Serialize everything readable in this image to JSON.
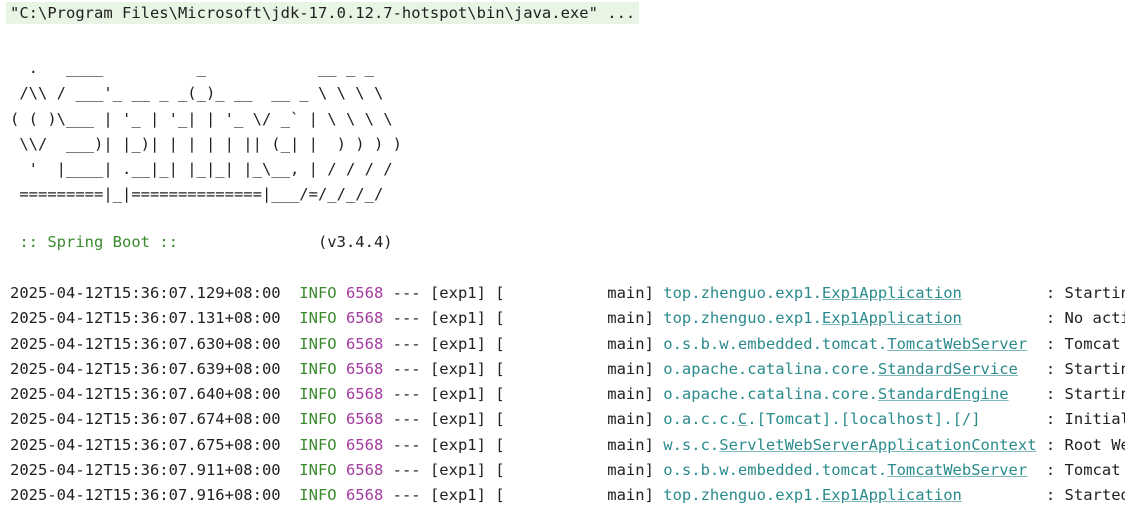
{
  "command": "\"C:\\Program Files\\Microsoft\\jdk-17.0.12.7-hotspot\\bin\\java.exe\" ...",
  "banner": "  .   ____          _            __ _ _\n /\\\\ / ___'_ __ _ _(_)_ __  __ _ \\ \\ \\ \\\n( ( )\\___ | '_ | '_| | '_ \\/ _` | \\ \\ \\ \\\n \\\\/  ___)| |_)| | | | | || (_| |  ) ) ) )\n  '  |____| .__|_| |_|_| |_\\__, | / / / /\n =========|_|==============|___/=/_/_/_/",
  "spring": {
    "label": " :: Spring Boot :: ",
    "padding": "              ",
    "version": "(v3.4.4)"
  },
  "colors": {
    "info": "#3a8a2e",
    "pid": "#a43aa0",
    "logger": "#2a8a8c",
    "command_bg": "#e8f5e4"
  },
  "logs": [
    {
      "timestamp": "2025-04-12T15:36:07.129+08:00",
      "level": "INFO",
      "pid": "6568",
      "sep": " --- [exp1] [           main] ",
      "logger_pkg": "top.zhenguo.exp1.",
      "logger_class": "Exp1Application",
      "logger_pad": "        ",
      "message": " : Starting Ex"
    },
    {
      "timestamp": "2025-04-12T15:36:07.131+08:00",
      "level": "INFO",
      "pid": "6568",
      "sep": " --- [exp1] [           main] ",
      "logger_pkg": "top.zhenguo.exp1.",
      "logger_class": "Exp1Application",
      "logger_pad": "        ",
      "message": " : No active p"
    },
    {
      "timestamp": "2025-04-12T15:36:07.630+08:00",
      "level": "INFO",
      "pid": "6568",
      "sep": " --- [exp1] [           main] ",
      "logger_pkg": "o.s.b.w.embedded.tomcat.",
      "logger_class": "TomcatWebServer",
      "logger_pad": " ",
      "message": " : Tomcat init"
    },
    {
      "timestamp": "2025-04-12T15:36:07.639+08:00",
      "level": "INFO",
      "pid": "6568",
      "sep": " --- [exp1] [           main] ",
      "logger_pkg": "o.apache.catalina.core.",
      "logger_class": "StandardService",
      "logger_pad": "  ",
      "message": " : Starting se"
    },
    {
      "timestamp": "2025-04-12T15:36:07.640+08:00",
      "level": "INFO",
      "pid": "6568",
      "sep": " --- [exp1] [           main] ",
      "logger_pkg": "o.apache.catalina.core.",
      "logger_class": "StandardEngine",
      "logger_pad": "   ",
      "message": " : Starting Se"
    },
    {
      "timestamp": "2025-04-12T15:36:07.674+08:00",
      "level": "INFO",
      "pid": "6568",
      "sep": " --- [exp1] [           main] ",
      "logger_pkg": "o.a.c.c.",
      "logger_class": "C",
      "logger_pad": ".[Tomcat].[localhost].[/]      ",
      "message": " : Initializin"
    },
    {
      "timestamp": "2025-04-12T15:36:07.675+08:00",
      "level": "INFO",
      "pid": "6568",
      "sep": " --- [exp1] [           main] ",
      "logger_pkg": "w.s.c.",
      "logger_class": "ServletWebServerApplicationContext",
      "logger_pad": "",
      "message": " : Root WebApp"
    },
    {
      "timestamp": "2025-04-12T15:36:07.911+08:00",
      "level": "INFO",
      "pid": "6568",
      "sep": " --- [exp1] [           main] ",
      "logger_pkg": "o.s.b.w.embedded.tomcat.",
      "logger_class": "TomcatWebServer",
      "logger_pad": " ",
      "message": " : Tomcat star"
    },
    {
      "timestamp": "2025-04-12T15:36:07.916+08:00",
      "level": "INFO",
      "pid": "6568",
      "sep": " --- [exp1] [           main] ",
      "logger_pkg": "top.zhenguo.exp1.",
      "logger_class": "Exp1Application",
      "logger_pad": "        ",
      "message": " : Started Exp"
    }
  ]
}
